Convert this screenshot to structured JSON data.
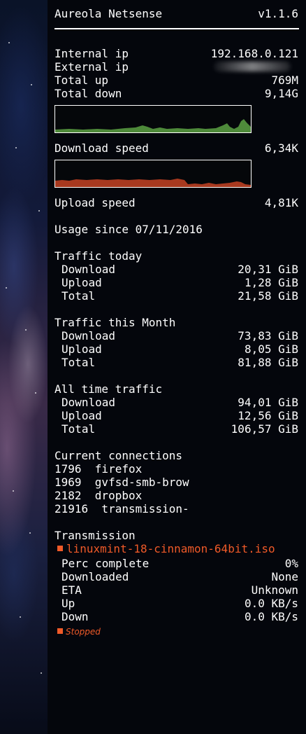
{
  "header": {
    "title": "Aureola Netsense",
    "version": "v1.1.6"
  },
  "network": {
    "internal_ip_label": "Internal ip",
    "internal_ip": "192.168.0.121",
    "external_ip_label": "External ip",
    "total_up_label": "Total up",
    "total_up": "769M",
    "total_down_label": "Total down",
    "total_down": "9,14G",
    "download_speed_label": "Download speed",
    "download_speed": "6,34K",
    "upload_speed_label": "Upload speed",
    "upload_speed": "4,81K",
    "usage_since": "Usage since 07/11/2016"
  },
  "graph_colors": {
    "download": "#4e8a3a",
    "upload": "#a8391f"
  },
  "traffic_today": {
    "title": "Traffic today",
    "download_label": "Download",
    "download": "20,31 GiB",
    "upload_label": "Upload",
    "upload": "1,28 GiB",
    "total_label": "Total",
    "total": "21,58 GiB"
  },
  "traffic_month": {
    "title": "Traffic this Month",
    "download_label": "Download",
    "download": "73,83 GiB",
    "upload_label": "Upload",
    "upload": "8,05 GiB",
    "total_label": "Total",
    "total": "81,88 GiB"
  },
  "traffic_all": {
    "title": "All time traffic",
    "download_label": "Download",
    "download": "94,01 GiB",
    "upload_label": "Upload",
    "upload": "12,56 GiB",
    "total_label": "Total",
    "total": "106,57 GiB"
  },
  "connections": {
    "title": "Current connections",
    "rows": [
      "1796  firefox",
      "1969  gvfsd-smb-brow",
      "2182  dropbox",
      "21916  transmission-"
    ]
  },
  "transmission": {
    "title": "Transmission",
    "file": "linuxmint-18-cinnamon-64bit.iso",
    "perc_label": "Perc complete",
    "perc": "0%",
    "downloaded_label": "Downloaded",
    "downloaded": "None",
    "eta_label": "ETA",
    "eta": "Unknown",
    "up_label": "Up",
    "up": "0.0 KB/s",
    "down_label": "Down",
    "down": "0.0 KB/s",
    "status": "Stopped",
    "accent_color": "#f05a28"
  }
}
